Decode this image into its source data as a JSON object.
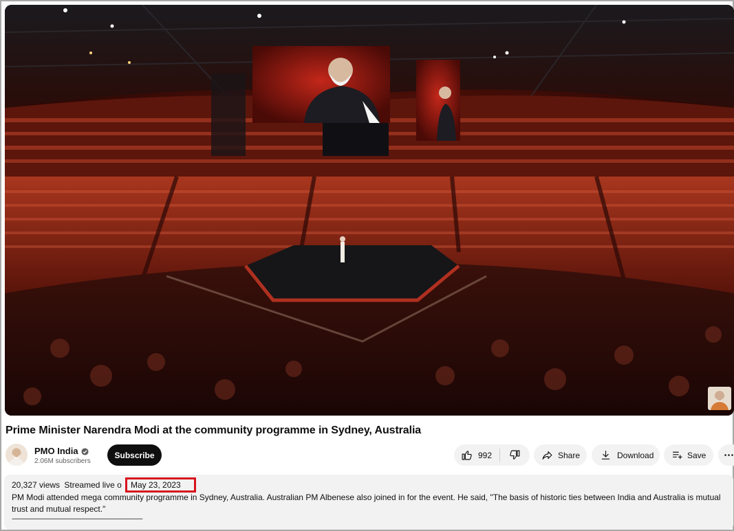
{
  "video": {
    "title": "Prime Minister Narendra Modi at the community programme in Sydney, Australia"
  },
  "channel": {
    "name": "PMO India",
    "subscribers": "2.06M subscribers",
    "subscribe_label": "Subscribe",
    "verified_icon": "check-circle-icon"
  },
  "actions": {
    "like_count": "992",
    "like_icon": "thumb-up-icon",
    "dislike_icon": "thumb-down-icon",
    "share_label": "Share",
    "share_icon": "share-arrow-icon",
    "download_label": "Download",
    "download_icon": "download-icon",
    "save_label": "Save",
    "save_icon": "playlist-add-icon",
    "more_icon": "more-horizontal-icon"
  },
  "description": {
    "views": "20,327 views",
    "streamed": "Streamed live o",
    "date": "May 23, 2023",
    "text": "PM Modi attended mega community programme in Sydney, Australia. Australian PM Albenese also joined in for the event. He said, \"The basis of historic ties between India and Australia is mutual trust and mutual respect.\"",
    "rule": "-----------------------------------------------------------------------------------------------"
  },
  "colors": {
    "subscribe_bg": "#0f0f0f",
    "pill_bg": "#f2f2f2",
    "highlight_box": "#d8121d",
    "secondary_text": "#606060"
  }
}
